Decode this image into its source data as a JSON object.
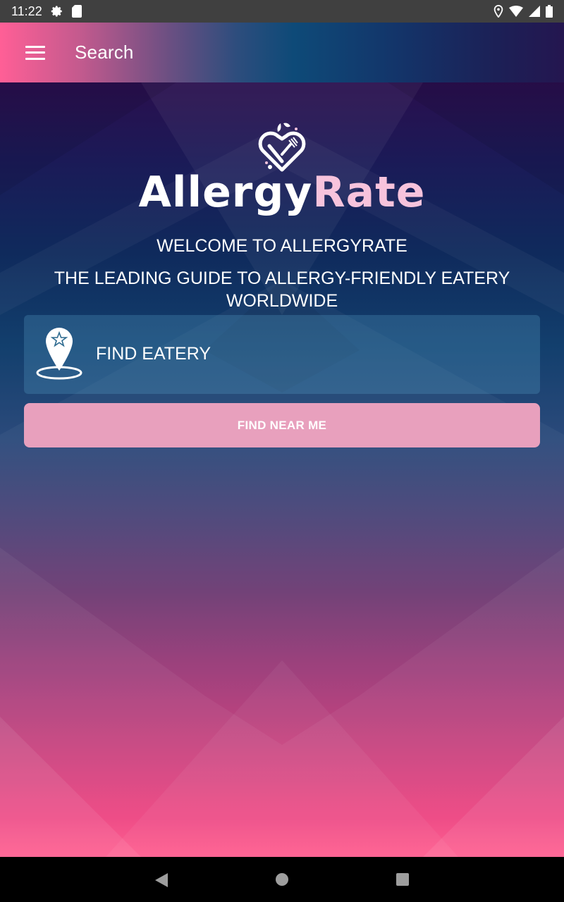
{
  "status_bar": {
    "time": "11:22",
    "icons_left": [
      "settings-icon",
      "sd-card-icon"
    ],
    "icons_right": [
      "location-icon",
      "wifi-icon",
      "signal-icon",
      "battery-icon"
    ]
  },
  "app_bar": {
    "menu_icon": "hamburger-menu-icon",
    "title": "Search"
  },
  "logo": {
    "icon": "heart-apple-fork-knife-icon",
    "text_part1": "Allergy",
    "text_part2": "Rate"
  },
  "welcome": "WELCOME TO ALLERGYRATE",
  "tagline": "THE LEADING GUIDE TO ALLERGY-FRIENDLY EATERY WORLDWIDE",
  "find_eatery": {
    "icon": "map-pin-star-icon",
    "label": "FIND EATERY"
  },
  "find_near_me": {
    "label": "FIND NEAR ME"
  },
  "colors": {
    "accent_pink": "#e8a0bd",
    "logo_pink": "#f7c3dc",
    "status_bar": "#404040"
  },
  "nav_bar": {
    "buttons": [
      "back",
      "home",
      "recents"
    ]
  }
}
